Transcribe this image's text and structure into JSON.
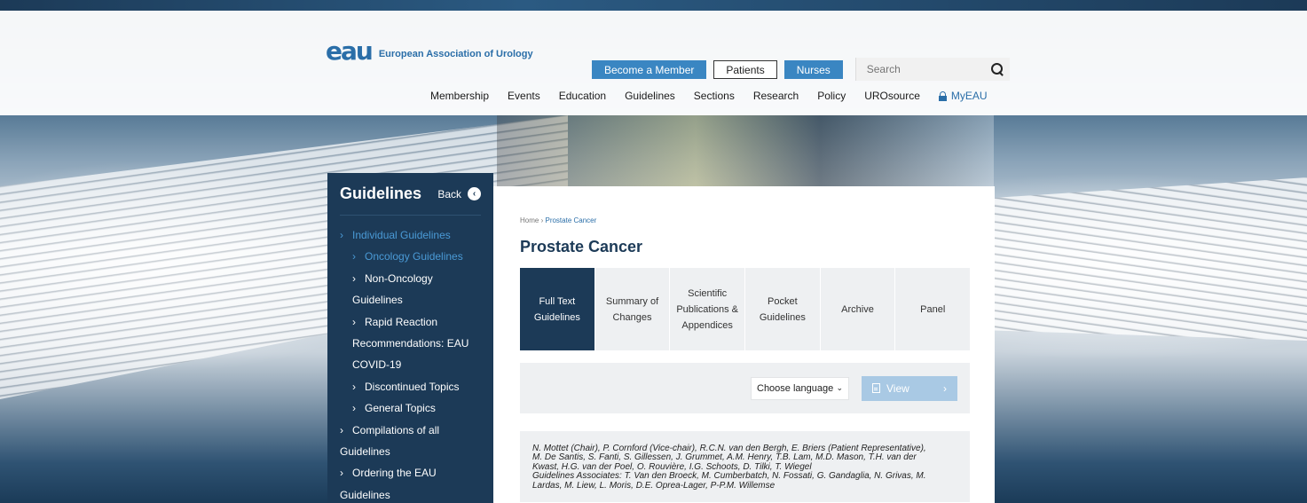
{
  "header": {
    "logo_mark": "eau",
    "logo_text": "European Association of Urology",
    "util_buttons": {
      "become_member": "Become a Member",
      "patients": "Patients",
      "nurses": "Nurses"
    },
    "search_placeholder": "Search",
    "nav": [
      "Membership",
      "Events",
      "Education",
      "Guidelines",
      "Sections",
      "Research",
      "Policy",
      "UROsource"
    ],
    "myeau": "MyEAU"
  },
  "sidebar": {
    "title": "Guidelines",
    "back_label": "Back",
    "items": [
      {
        "label": "Individual Guidelines",
        "level": 1
      },
      {
        "label": "Oncology Guidelines",
        "level": 2
      },
      {
        "label": "Non-Oncology",
        "level": 2
      },
      {
        "label": "Guidelines",
        "level": 2,
        "continuation": true
      },
      {
        "label": "Rapid Reaction",
        "level": 2
      },
      {
        "label": "Recommendations: EAU",
        "level": 2,
        "continuation": true
      },
      {
        "label": "COVID-19",
        "level": 2,
        "continuation": true
      },
      {
        "label": "Discontinued Topics",
        "level": 2
      },
      {
        "label": "General Topics",
        "level": 2
      },
      {
        "label": "Compilations of all",
        "level": 1
      },
      {
        "label": "Guidelines",
        "level": 1,
        "continuation": true
      },
      {
        "label": "Ordering the EAU",
        "level": 1
      },
      {
        "label": "Guidelines",
        "level": 1,
        "continuation": true
      }
    ]
  },
  "content": {
    "breadcrumb": {
      "home": "Home",
      "separator": "›",
      "current": "Prostate Cancer"
    },
    "title": "Prostate Cancer",
    "tabs": [
      {
        "label": "Full Text Guidelines",
        "active": true
      },
      {
        "label": "Summary of Changes",
        "active": false
      },
      {
        "label": "Scientific Publications & Appendices",
        "active": false
      },
      {
        "label": "Pocket Guidelines",
        "active": false
      },
      {
        "label": "Archive",
        "active": false
      },
      {
        "label": "Panel",
        "active": false
      }
    ],
    "language_select": "Choose language",
    "view_button": "View",
    "authors": [
      "N. Mottet (Chair), P. Cornford (Vice-chair), R.C.N. van den Bergh, E. Briers (Patient Representative),",
      "M. De Santis, S. Fanti, S. Gillessen, J. Grummet, A.M. Henry, T.B. Lam, M.D. Mason, T.H. van der",
      "Kwast, H.G. van der Poel, O. Rouvière, I.G. Schoots, D. Tilki, T. Wiegel",
      "Guidelines Associates: T. Van den Broeck, M. Cumberbatch, N. Fossati, G. Gandaglia, N. Grivas, M.",
      "Lardas, M. Liew, L. Moris, D.E. Oprea-Lager, P-P.M. Willemse"
    ]
  },
  "colors": {
    "navy": "#1c3a57",
    "brand_blue": "#2a6ea8",
    "button_blue": "#3a86c2",
    "active_link": "#4a9ad6",
    "panel_gray": "#eef0f2"
  }
}
